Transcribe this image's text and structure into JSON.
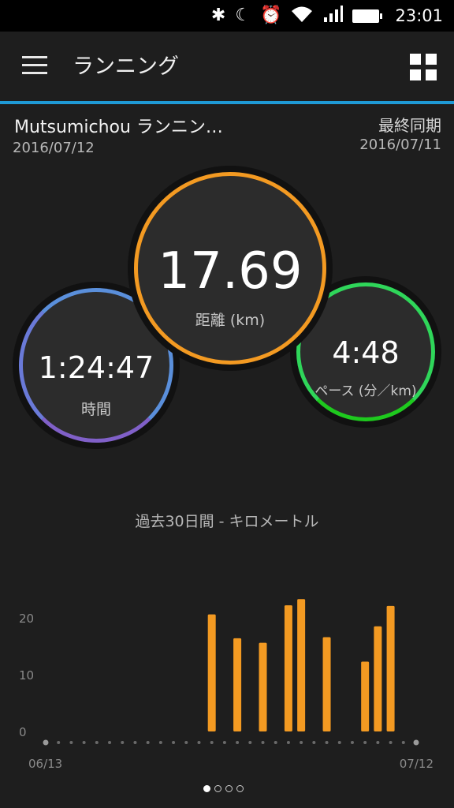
{
  "status": {
    "icons": [
      "bluetooth-icon",
      "moon-icon",
      "alarm-icon",
      "wifi-icon",
      "signal-icon",
      "battery-icon"
    ],
    "time": "23:01"
  },
  "appbar": {
    "title": "ランニング"
  },
  "activity": {
    "name": "Mutsumichou ランニン…",
    "date": "2016/07/12",
    "sync_label": "最終同期",
    "sync_date": "2016/07/11"
  },
  "stats": {
    "distance": {
      "value": "17.69",
      "label": "距離 (km)",
      "color": "#f39a22"
    },
    "time": {
      "value": "1:24:47",
      "label": "時間",
      "color": "#5a8fdb"
    },
    "pace": {
      "value": "4:48",
      "label": "ペース (分／km)",
      "color": "#2fd65a"
    }
  },
  "chart_data": {
    "type": "bar",
    "title": "過去30日間 - キロメートル",
    "ylim": [
      0,
      25
    ],
    "yticks": [
      "0",
      "10",
      "20"
    ],
    "x_start_label": "06/13",
    "x_end_label": "07/12",
    "days": 30,
    "values": [
      0,
      0,
      0,
      0,
      0,
      0,
      0,
      0,
      0,
      0,
      0,
      0,
      0,
      20.6,
      0,
      16.4,
      0,
      15.6,
      0,
      22.2,
      23.3,
      0,
      16.6,
      0,
      0,
      12.3,
      18.5,
      22.1,
      0,
      0
    ],
    "bar_color": "#f39a22",
    "grid": false
  },
  "pager": {
    "count": 4,
    "active": 0
  }
}
